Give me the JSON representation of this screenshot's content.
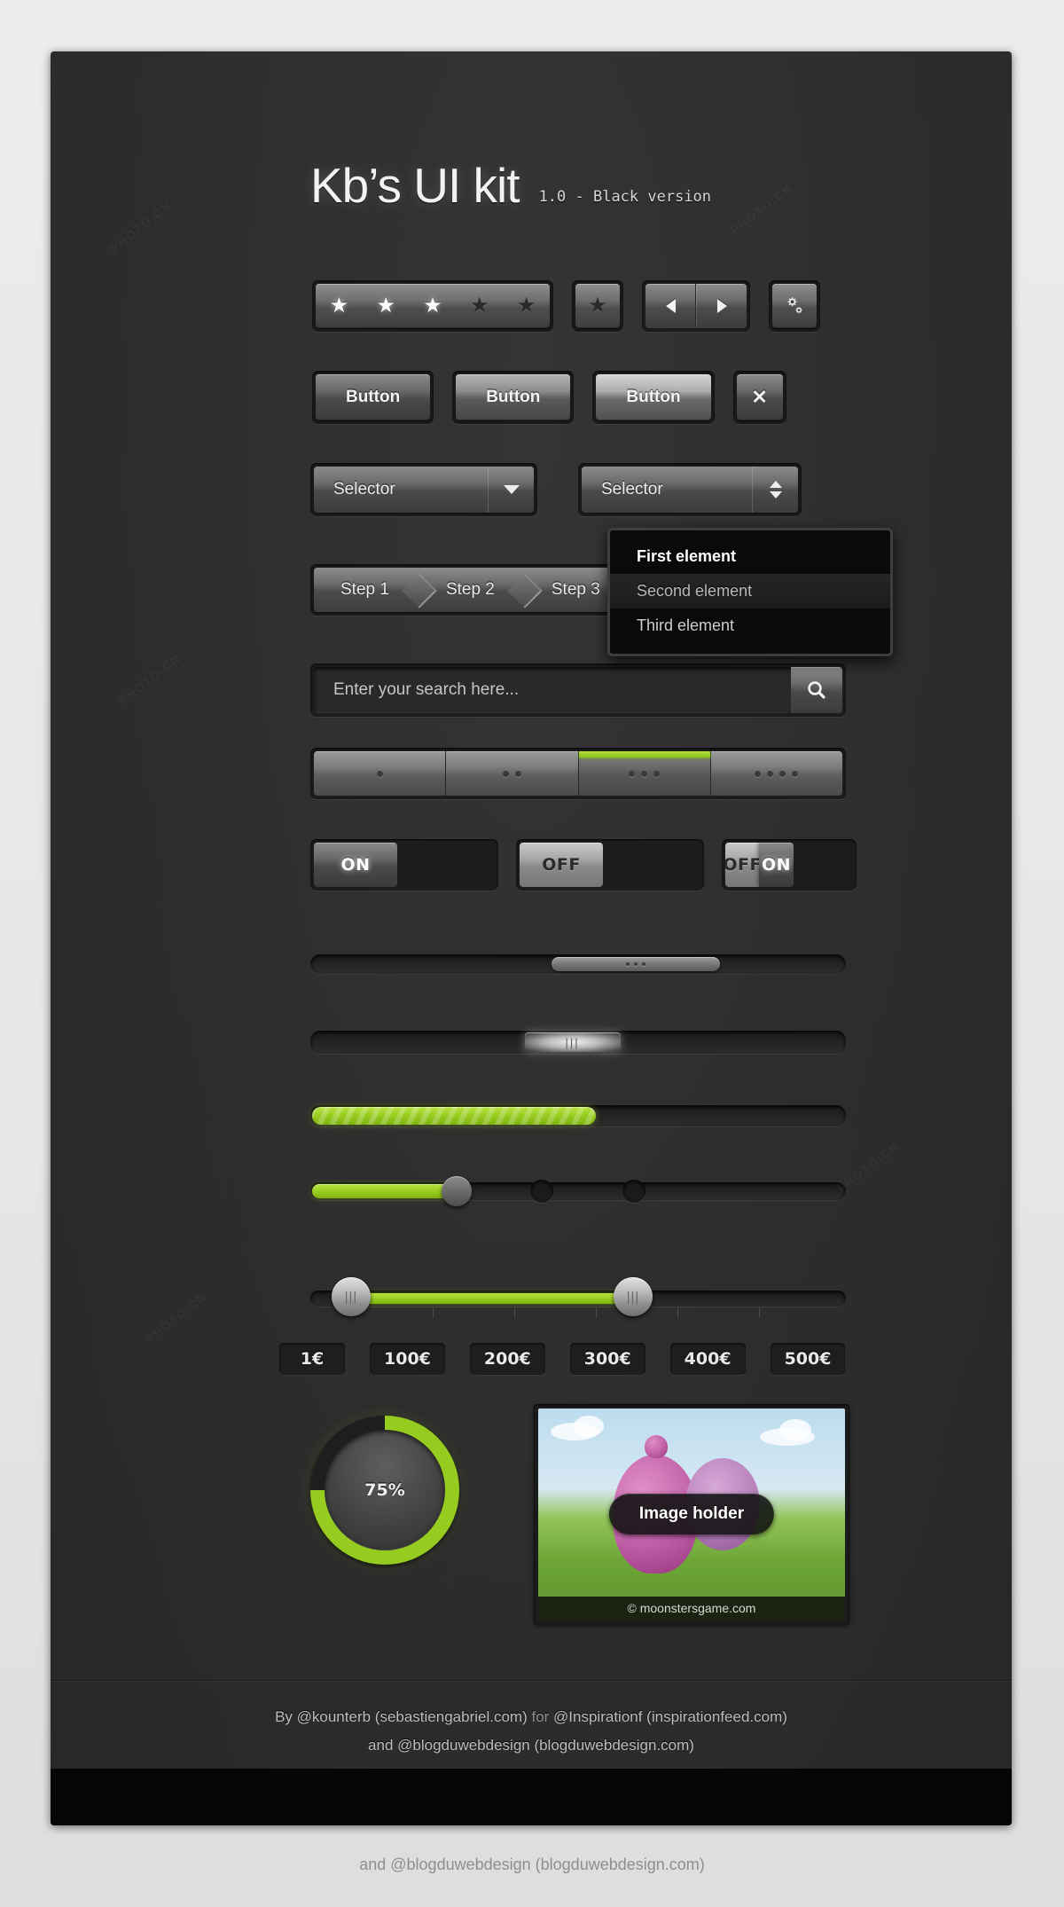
{
  "header": {
    "title": "Kb’s UI kit",
    "version": "1.0 - Black version"
  },
  "colors": {
    "accent_green": "#96cb1f",
    "accent_green_light": "#b8e441",
    "panel_bg": "#2e2e2e",
    "frame_dark": "#1c1c1c",
    "text_light": "#f2f2f2"
  },
  "rating": {
    "name": "star-rating",
    "value": 3,
    "max": 5,
    "star_glyph": "★",
    "single_star_button": "★"
  },
  "nav_arrows": {
    "prev_label": "prev-arrow",
    "next_label": "next-arrow"
  },
  "settings_button": {
    "icon": "gear-icon"
  },
  "buttons": [
    {
      "label": "Button",
      "style": "dim"
    },
    {
      "label": "Button",
      "style": "medium"
    },
    {
      "label": "Button",
      "style": "bright"
    }
  ],
  "close_button": {
    "label": "✕"
  },
  "selectors": [
    {
      "label": "Selector",
      "control": "chevron-down"
    },
    {
      "label": "Selector",
      "control": "stepper-up-down"
    }
  ],
  "dropdown": {
    "items": [
      {
        "label": "First element",
        "state": "selected"
      },
      {
        "label": "Second element",
        "state": "hover"
      },
      {
        "label": "Third element",
        "state": "normal"
      }
    ]
  },
  "steps": [
    {
      "label": "Step 1"
    },
    {
      "label": "Step 2"
    },
    {
      "label": "Step 3"
    }
  ],
  "search": {
    "placeholder": "Enter your search here...",
    "value": "",
    "button_icon": "search-icon"
  },
  "segmented": {
    "cells": [
      {
        "dots": 1,
        "active": false
      },
      {
        "dots": 2,
        "active": false
      },
      {
        "dots": 3,
        "active": true
      },
      {
        "dots": 4,
        "active": false
      }
    ]
  },
  "toggles": [
    {
      "name": "toggle-on",
      "knob_label": "ON",
      "knob_side": "left",
      "state": "on"
    },
    {
      "name": "toggle-off",
      "knob_label": "OFF",
      "knob_side": "right",
      "state": "off"
    },
    {
      "name": "toggle-pair",
      "left_label": "OFF",
      "right_label": "ON",
      "state": "on"
    }
  ],
  "scrollbars": [
    {
      "name": "scrollbar-grip-dots",
      "thumb_position_pct": 45,
      "grip": "three-dots"
    },
    {
      "name": "scrollbar-glow",
      "thumb_position_pct": 40,
      "grip": "|||"
    }
  ],
  "progress": {
    "name": "progress-bar",
    "value_pct": 53,
    "striped": true
  },
  "slider": {
    "name": "volume-slider",
    "value_pct": 27,
    "handles": [
      {
        "type": "filled",
        "position_pct": 27
      },
      {
        "type": "empty",
        "position_pct": 38
      },
      {
        "type": "empty",
        "position_pct": 55
      }
    ]
  },
  "range_slider": {
    "name": "price-range-slider",
    "low_pct": 7,
    "high_pct": 60,
    "handle_grip": "|||"
  },
  "price_labels": [
    "1€",
    "100€",
    "200€",
    "300€",
    "400€",
    "500€"
  ],
  "gauge": {
    "name": "radial-progress",
    "value_pct": 75,
    "label": "75%"
  },
  "image_holder": {
    "label": "Image holder",
    "credit": "© moonstersgame.com"
  },
  "footer": {
    "line1_a": "By @kounterb (sebastiengabriel.com)",
    "line1_b": " for ",
    "line1_c": "@Inspirationf (inspirationfeed.com)",
    "line2": "and @blogduwebdesign (blogduwebdesign.com)"
  },
  "page_caption": "and @blogduwebdesign (blogduwebdesign.com)"
}
